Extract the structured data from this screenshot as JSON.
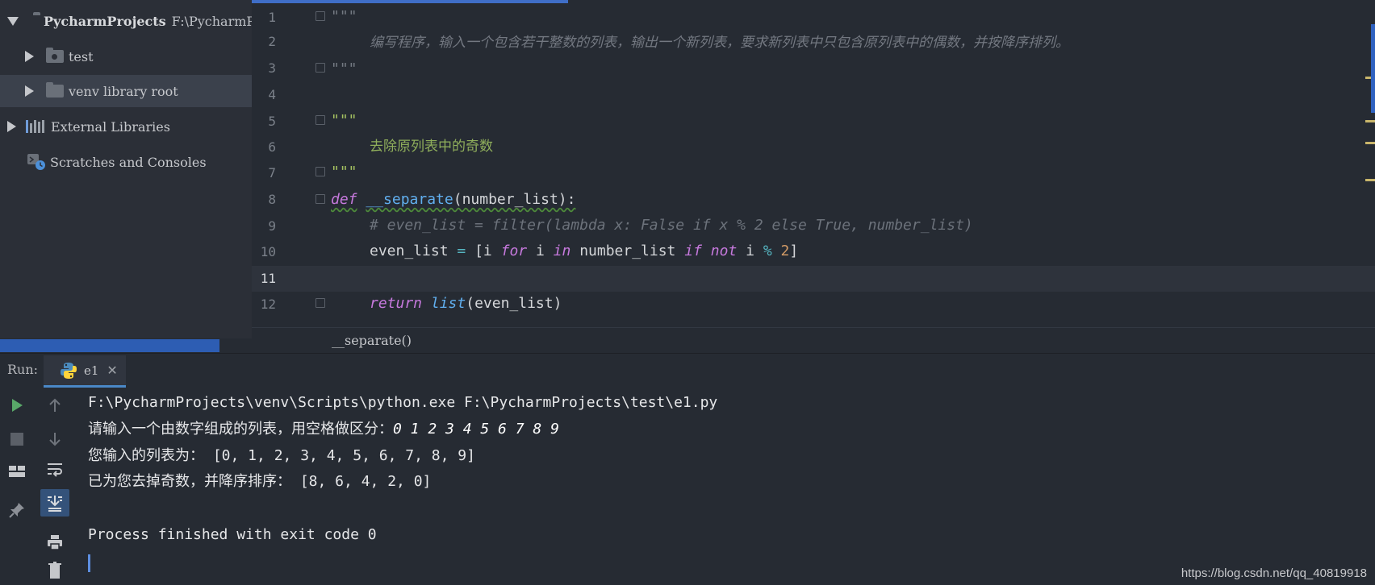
{
  "project": {
    "name": "PycharmProjects",
    "path": "F:\\PycharmPro",
    "items": [
      {
        "label": "test"
      },
      {
        "label": "venv library root"
      },
      {
        "label": "External Libraries"
      },
      {
        "label": "Scratches and Consoles"
      }
    ]
  },
  "editor": {
    "line_numbers": [
      "1",
      "2",
      "3",
      "4",
      "5",
      "6",
      "7",
      "8",
      "9",
      "10",
      "11",
      "12"
    ],
    "docstring_open": "\"\"\"",
    "line2_text": "编写程序，输入一个包含若干整数的列表，输出一个新列表，要求新列表中只包含原列表中的偶数，并按降序排列。",
    "line6_text": "去除原列表中的奇数",
    "line8": {
      "kw": "def",
      "name": "__separate",
      "params": "(number_list):"
    },
    "line9_comment": "# even_list = filter(lambda x: False if x % 2 else True, number_list)",
    "line10": {
      "target": "even_list",
      "eq": "=",
      "open": "[i",
      "for": "for",
      "i": "i",
      "in": "in",
      "src": "number_list",
      "if": "if",
      "not": "not",
      "i2": "i",
      "mod": "%",
      "two": "2",
      "close": "]"
    },
    "line12": {
      "kw": "return",
      "fn": "list",
      "args": "(even_list)"
    },
    "breadcrumb": "__separate()"
  },
  "run": {
    "label": "Run:",
    "tab": "e1",
    "console": {
      "cmd": "F:\\PycharmProjects\\venv\\Scripts\\python.exe F:\\PycharmProjects\\test\\e1.py",
      "prompt": "请输入一个由数字组成的列表，用空格做区分：",
      "input": "0 1 2 3 4 5 6 7 8 9",
      "echo_label": "您输入的列表为：",
      "echo_value": " [0, 1, 2, 3, 4, 5, 6, 7, 8, 9]",
      "result_label": "已为您去掉奇数，并降序排序：",
      "result_value": " [8, 6, 4, 2, 0]",
      "exit": "Process finished with exit code 0"
    }
  },
  "watermark": "https://blog.csdn.net/qq_40819918",
  "colors": {
    "accent": "#2d5db3",
    "background": "#262b33",
    "run_green": "#59a869"
  }
}
